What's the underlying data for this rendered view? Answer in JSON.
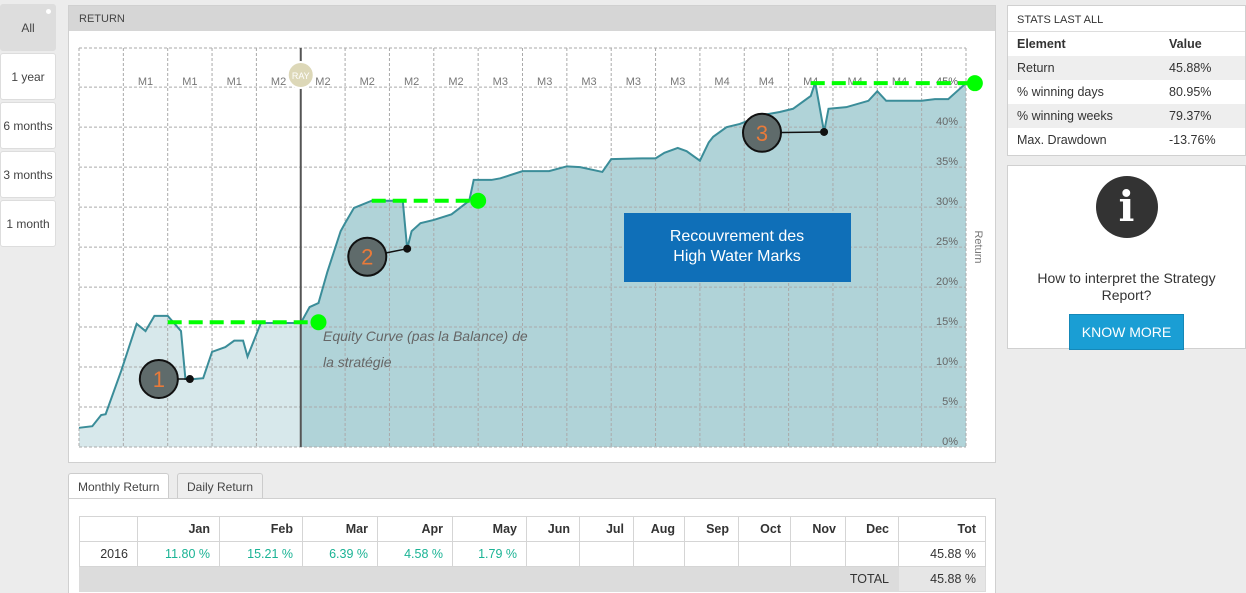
{
  "range_nav": [
    {
      "label": "All",
      "selected": true
    },
    {
      "label": "1 year"
    },
    {
      "label": "6 months"
    },
    {
      "label": "3 months"
    },
    {
      "label": "1 month"
    }
  ],
  "chart_panel": {
    "title": "RETURN"
  },
  "chart_data": {
    "type": "area",
    "title": "RETURN",
    "ylabel": "Return",
    "xlim": [
      0,
      200
    ],
    "ylim": [
      0,
      49.9
    ],
    "y_ticks": [
      0,
      5,
      10,
      15,
      20,
      25,
      30,
      35,
      40,
      45
    ],
    "y_tick_labels": [
      "0%",
      "5%",
      "10%",
      "15%",
      "20%",
      "25%",
      "30%",
      "35%",
      "40%",
      "45%"
    ],
    "x_tick_labels": [
      "M1",
      "M1",
      "M1",
      "M2",
      "M2",
      "M2",
      "M2",
      "M2",
      "M3",
      "M3",
      "M3",
      "M3",
      "M3",
      "M4",
      "M4",
      "M4",
      "M4",
      "M4"
    ],
    "grid": true,
    "split_x": 50,
    "split_label": "RAY",
    "series": [
      {
        "name": "Equity Curve",
        "x": [
          0,
          3,
          5,
          6,
          9.5,
          13,
          15,
          17,
          20,
          23,
          24,
          26,
          28,
          30,
          33,
          35,
          37,
          38,
          40,
          41,
          50,
          52,
          54,
          56,
          59,
          60,
          62,
          66,
          73,
          74,
          75,
          77,
          80,
          84,
          88,
          89,
          93,
          95,
          100,
          106,
          110,
          113,
          118,
          120,
          127,
          130,
          132,
          135,
          137,
          140,
          142,
          143,
          146,
          149,
          154,
          158,
          161,
          165,
          166,
          168,
          169,
          173,
          178,
          180,
          182,
          190,
          193,
          196,
          200
        ],
        "y": [
          2.4,
          2.6,
          4.0,
          4.1,
          9.5,
          15.4,
          14.5,
          16.4,
          16.4,
          14.5,
          8.5,
          8.5,
          8.6,
          11.9,
          12.5,
          13.3,
          13.3,
          11.3,
          14.1,
          15.5,
          15.5,
          17.5,
          18.0,
          21.9,
          27.0,
          28.0,
          29.9,
          30.8,
          30.8,
          24.8,
          27.0,
          28.0,
          28.4,
          29.1,
          30.8,
          33.4,
          33.4,
          33.6,
          34.5,
          34.5,
          35.1,
          35.0,
          34.4,
          36.0,
          36.1,
          36.1,
          36.8,
          37.4,
          37.0,
          35.8,
          38.1,
          38.8,
          40.0,
          40.4,
          41.5,
          41.9,
          42.3,
          43.9,
          45.6,
          39.4,
          42.3,
          42.5,
          43.3,
          44.5,
          43.3,
          43.3,
          43.5,
          43.5,
          45.5
        ]
      }
    ],
    "high_water_marks": [
      {
        "x0": 20,
        "x1": 54,
        "y": 15.6
      },
      {
        "x0": 66,
        "x1": 90,
        "y": 30.8
      },
      {
        "x0": 165,
        "x1": 202,
        "y": 45.5
      }
    ],
    "drawdowns": [
      {
        "label": "1",
        "x": 25,
        "y": 8.5,
        "cx": 18,
        "cy": 8.5
      },
      {
        "label": "2",
        "x": 74,
        "y": 24.8,
        "cx": 65,
        "cy": 23.8
      },
      {
        "label": "3",
        "x": 168,
        "y": 39.4,
        "cx": 154,
        "cy": 39.3
      }
    ],
    "annotations": {
      "box": [
        "Recouvrement des",
        "High Water Marks"
      ],
      "note": [
        "Equity Curve (pas la Balance) de",
        "la stratégie"
      ]
    }
  },
  "tabs": [
    {
      "label": "Monthly Return",
      "active": true
    },
    {
      "label": "Daily Return"
    }
  ],
  "monthly": {
    "headers": [
      "",
      "Jan",
      "Feb",
      "Mar",
      "Apr",
      "May",
      "Jun",
      "Jul",
      "Aug",
      "Sep",
      "Oct",
      "Nov",
      "Dec",
      "Tot"
    ],
    "rows": [
      [
        "2016",
        "11.80 %",
        "15.21 %",
        "6.39 %",
        "4.58 %",
        "1.79 %",
        "",
        "",
        "",
        "",
        "",
        "",
        "",
        "45.88 %"
      ]
    ],
    "total_label": "TOTAL",
    "total_value": "45.88 %"
  },
  "stats": {
    "title": "STATS LAST ALL",
    "headers": [
      "Element",
      "Value"
    ],
    "rows": [
      [
        "Return",
        "45.88%"
      ],
      [
        "% winning days",
        "80.95%"
      ],
      [
        "% winning weeks",
        "79.37%"
      ],
      [
        "Max. Drawdown",
        "-13.76%"
      ]
    ]
  },
  "info": {
    "question": "How to interpret the Strategy Report?",
    "button": "KNOW MORE"
  },
  "colors": {
    "line": "#3b8d99",
    "fill_dark": "#b0d3d8",
    "fill_light": "#d7e8eb",
    "hwm": "#00ff00",
    "box": "#0f6fb8",
    "positive": "#1ab394"
  }
}
